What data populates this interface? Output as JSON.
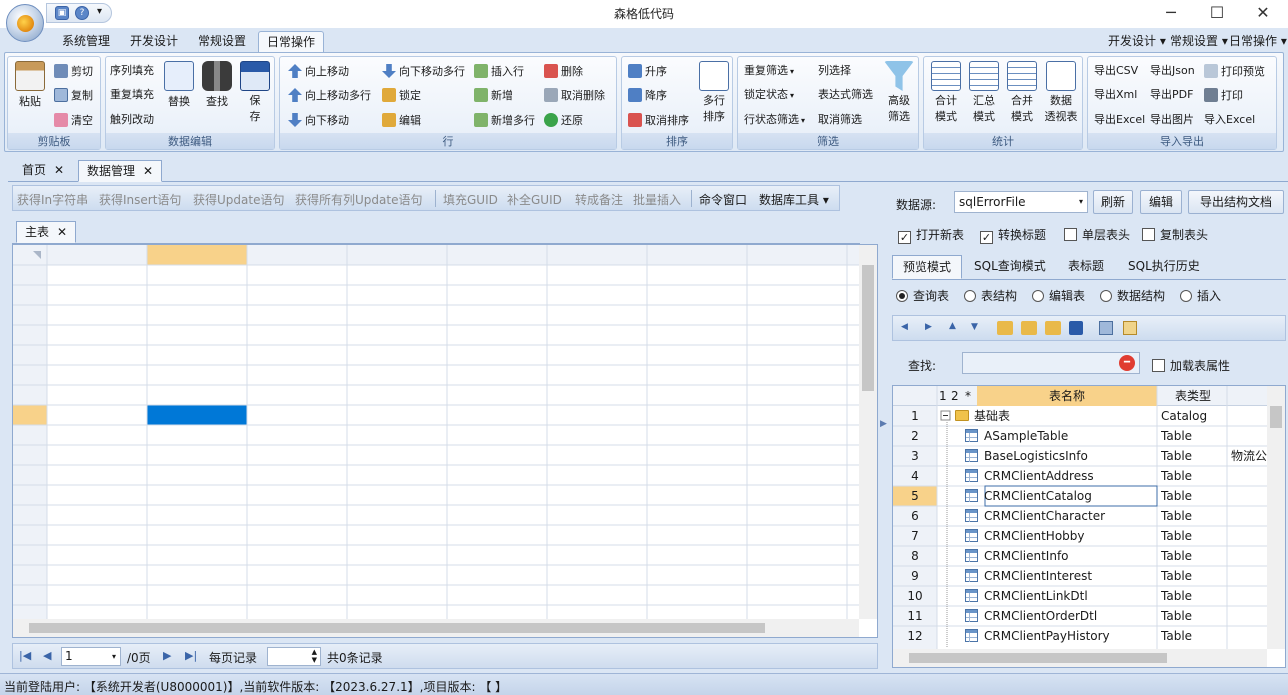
{
  "window": {
    "title": "森格低代码",
    "minimize": "─",
    "maximize": "☐",
    "close": "✕"
  },
  "quick_access": {
    "save": "▣",
    "help": "?",
    "more": "▾"
  },
  "ribbon_tabs": [
    "系统管理",
    "开发设计",
    "常规设置",
    "日常操作"
  ],
  "ribbon_right": [
    "开发设计 ▾",
    "常规设置 ▾",
    "日常操作 ▾"
  ],
  "ribbon": {
    "clipboard": {
      "label": "剪贴板",
      "paste": "粘贴",
      "cut": "剪切",
      "copy": "复制",
      "clear": "清空"
    },
    "data_edit": {
      "label": "数据编辑",
      "seq_fill": "序列填充",
      "repeat_fill": "重复填充",
      "trigger_change": "触列改动",
      "replace": "替换",
      "find": "查找",
      "save1": "保",
      "save2": "存"
    },
    "row": {
      "label": "行",
      "move_up": "向上移动",
      "move_up_multi": "向上移动多行",
      "move_down": "向下移动",
      "move_down_multi": "向下移动多行",
      "lock": "锁定",
      "edit": "编辑",
      "insert_row": "插入行",
      "add": "新增",
      "add_multi": "新增多行",
      "delete": "删除",
      "cancel_delete": "取消删除",
      "restore": "还原"
    },
    "sort": {
      "label": "排序",
      "asc": "升序",
      "desc": "降序",
      "cancel_sort": "取消排序",
      "multi_sort1": "多行",
      "multi_sort2": "排序"
    },
    "filter": {
      "label": "筛选",
      "dup_filter": "重复筛选",
      "lock_state": "锁定状态",
      "row_state_filter": "行状态筛选",
      "col_select": "列选择",
      "expr_filter": "表达式筛选",
      "cancel_filter": "取消筛选",
      "adv_filter1": "高级",
      "adv_filter2": "筛选"
    },
    "stats": {
      "label": "统计",
      "total1": "合计",
      "total2": "模式",
      "summary1": "汇总",
      "summary2": "模式",
      "merge1": "合并",
      "merge2": "模式",
      "pivot1": "数据",
      "pivot2": "透视表"
    },
    "io": {
      "label": "导入导出",
      "csv": "导出CSV",
      "json": "导出Json",
      "print_preview": "打印预览",
      "xml": "导出Xml",
      "pdf": "导出PDF",
      "print": "打印",
      "excel_out": "导出Excel",
      "image": "导出图片",
      "excel_in": "导入Excel"
    }
  },
  "doc_tabs": [
    {
      "label": "首页"
    },
    {
      "label": "数据管理"
    }
  ],
  "close_glyph": "✕",
  "sql_toolbar": [
    "获得In字符串",
    "获得Insert语句",
    "获得Update语句",
    "获得所有列Update语句",
    "填充GUID",
    "补全GUID",
    "转成备注",
    "批量插入",
    "命令窗口",
    "数据库工具 ▾"
  ],
  "subtab": {
    "label": "主表"
  },
  "pager": {
    "page": "1",
    "total_pages": "/0页",
    "per_page_label": "每页记录",
    "total": "共0条记录"
  },
  "right": {
    "datasource_label": "数据源:",
    "datasource_value": "sqlErrorFile",
    "refresh": "刷新",
    "edit": "编辑",
    "export_doc": "导出结构文档",
    "checks": [
      {
        "label": "打开新表",
        "checked": "✓"
      },
      {
        "label": "转换标题",
        "checked": "✓"
      },
      {
        "label": "单层表头",
        "checked": ""
      },
      {
        "label": "复制表头",
        "checked": ""
      }
    ],
    "tabs": [
      "预览模式",
      "SQL查询模式",
      "表标题",
      "SQL执行历史"
    ],
    "radios": [
      "查询表",
      "表结构",
      "编辑表",
      "数据结构",
      "插入"
    ],
    "search_label": "查找:",
    "load_props": "加载表属性",
    "tree_header": {
      "level1": "1",
      "level2": "2",
      "star": "*",
      "name": "表名称",
      "type": "表类型"
    },
    "rows": [
      {
        "no": "1",
        "name": "基础表",
        "type": "Catalog",
        "extra": ""
      },
      {
        "no": "2",
        "name": "ASampleTable",
        "type": "Table",
        "extra": ""
      },
      {
        "no": "3",
        "name": "BaseLogisticsInfo",
        "type": "Table",
        "extra": "物流公"
      },
      {
        "no": "4",
        "name": "CRMClientAddress",
        "type": "Table",
        "extra": ""
      },
      {
        "no": "5",
        "name": "CRMClientCatalog",
        "type": "Table",
        "extra": ""
      },
      {
        "no": "6",
        "name": "CRMClientCharacter",
        "type": "Table",
        "extra": ""
      },
      {
        "no": "7",
        "name": "CRMClientHobby",
        "type": "Table",
        "extra": ""
      },
      {
        "no": "8",
        "name": "CRMClientInfo",
        "type": "Table",
        "extra": ""
      },
      {
        "no": "9",
        "name": "CRMClientInterest",
        "type": "Table",
        "extra": ""
      },
      {
        "no": "10",
        "name": "CRMClientLinkDtl",
        "type": "Table",
        "extra": ""
      },
      {
        "no": "11",
        "name": "CRMClientOrderDtl",
        "type": "Table",
        "extra": ""
      },
      {
        "no": "12",
        "name": "CRMClientPayHistory",
        "type": "Table",
        "extra": ""
      }
    ]
  },
  "status": "当前登陆用户: 【系统开发者(U8000001)】,当前软件版本: 【2023.6.27.1】,项目版本: 【 】",
  "colors": {
    "accent": "#0078d7",
    "selected_header": "#f8d28a",
    "ribbon_border": "#99b3d6"
  }
}
